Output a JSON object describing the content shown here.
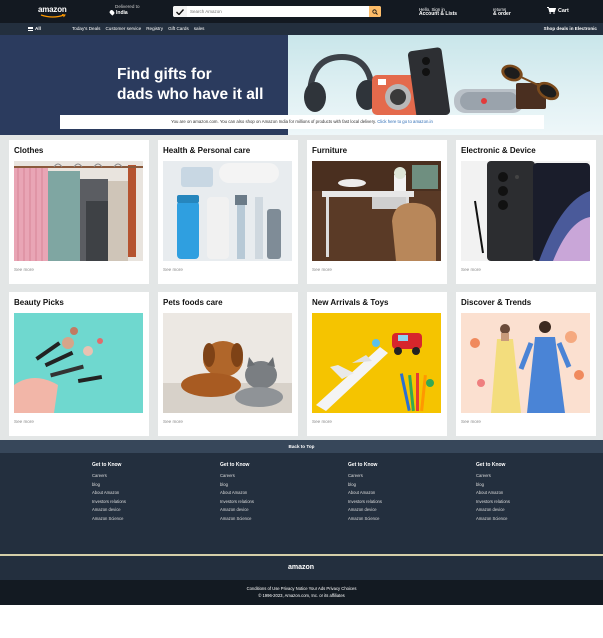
{
  "nav": {
    "logo_text": "amazon",
    "deliver_line1": "Delivered to",
    "deliver_line2": "India",
    "search_placeholder": "Search Amazon",
    "account_line1": "Hello, Sign in",
    "account_line2": "Account & Lists",
    "orders_line1": "returns",
    "orders_line2": "& order",
    "cart_label": "Cart"
  },
  "subnav": {
    "all_label": "All",
    "links": [
      "Today's Deals",
      "Customer service",
      "Registry",
      "Gift Cards",
      "sales"
    ],
    "right_label": "Shop deals in Electronic"
  },
  "hero": {
    "line1": "Find gifts for",
    "line2": "dads who have it all",
    "notice_text": "You are on amazon.com. You can also shop on Amazon India for millions of products with fast local delivery.",
    "notice_link": "Click here to go to amazon.in"
  },
  "cards": [
    {
      "title": "Clothes",
      "more": "See more"
    },
    {
      "title": "Health & Personal care",
      "more": "See more"
    },
    {
      "title": "Furniture",
      "more": "See more"
    },
    {
      "title": "Electronic & Device",
      "more": "See more"
    },
    {
      "title": "Beauty Picks",
      "more": "See more"
    },
    {
      "title": "Pets foods care",
      "more": "See more"
    },
    {
      "title": "New Arrivals & Toys",
      "more": "See more"
    },
    {
      "title": "Discover & Trends",
      "more": "See more"
    }
  ],
  "footer": {
    "back_to_top": "Back to Top",
    "columns": [
      {
        "heading": "Get to Know",
        "items": [
          "Careers",
          "blog",
          "About Amazon",
          "Investors relations",
          "Amazon device",
          "Amazon Science"
        ]
      },
      {
        "heading": "Get to Know",
        "items": [
          "Careers",
          "blog",
          "About Amazon",
          "Investors relations",
          "Amazon device",
          "Amazon Science"
        ]
      },
      {
        "heading": "Get to Know",
        "items": [
          "Careers",
          "blog",
          "About Amazon",
          "Investors relations",
          "Amazon device",
          "Amazon Science"
        ]
      },
      {
        "heading": "Get to Know",
        "items": [
          "Careers",
          "blog",
          "About Amazon",
          "Investors relations",
          "Amazon device",
          "Amazon Science"
        ]
      }
    ],
    "logo_text": "amazon",
    "legal_line1": "Conditions of Use Privacy Notice Your Ads Privacy Choices",
    "legal_line2": "© 1996-2023, Amazon.com, Inc. or its affiliates"
  },
  "colors": {
    "nav_bg": "#131921",
    "subnav_bg": "#232f3e",
    "accent": "#febd69",
    "hero_bg": "#2b3b5e"
  }
}
